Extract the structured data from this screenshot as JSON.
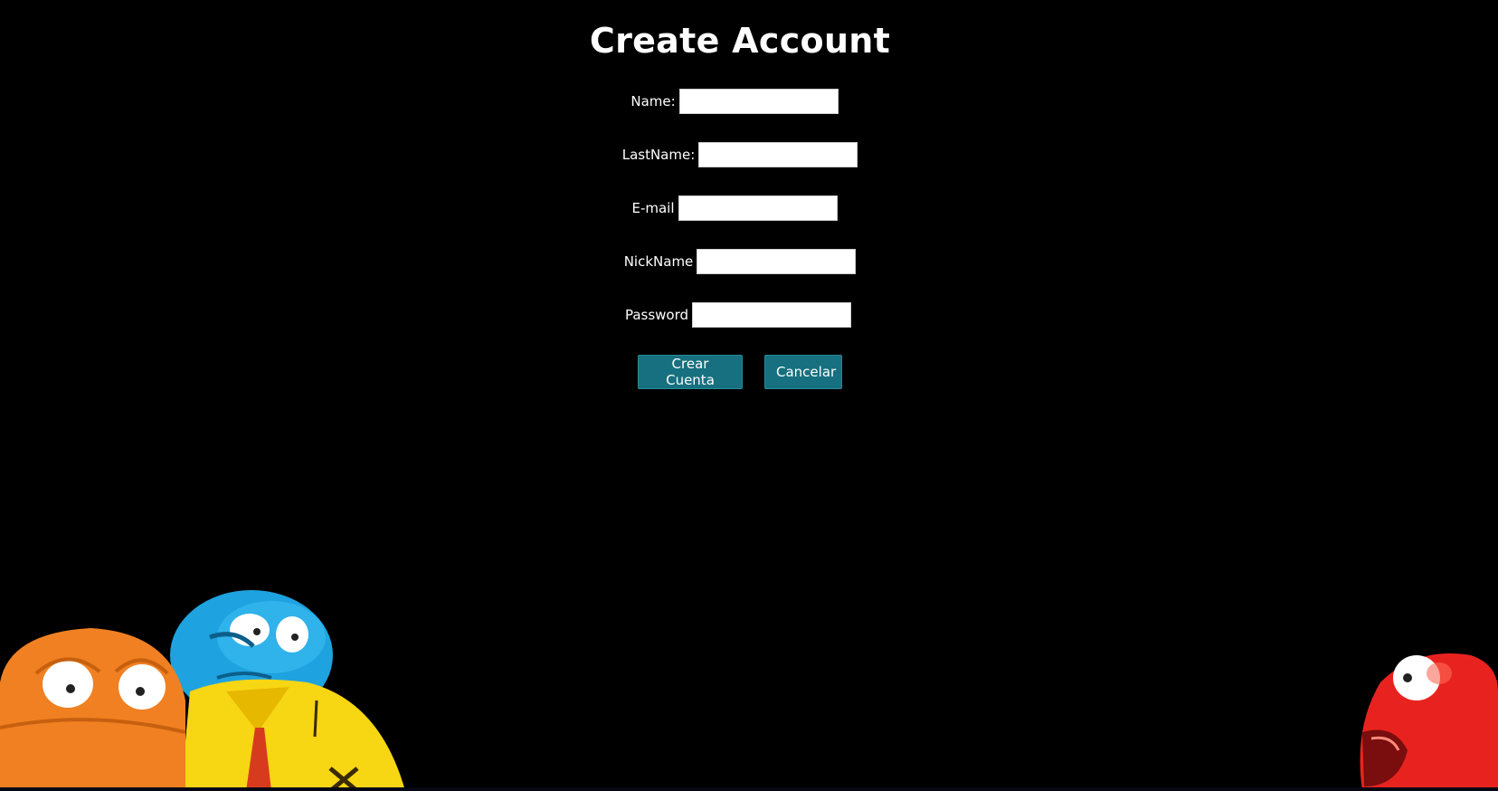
{
  "page": {
    "title": "Create Account"
  },
  "form": {
    "fields": [
      {
        "label": "Name:",
        "value": "",
        "placeholder": ""
      },
      {
        "label": "LastName:",
        "value": "",
        "placeholder": ""
      },
      {
        "label": "E-mail",
        "value": "",
        "placeholder": ""
      },
      {
        "label": "NickName",
        "value": "",
        "placeholder": ""
      },
      {
        "label": "Password",
        "value": "",
        "placeholder": ""
      }
    ],
    "buttons": {
      "create_label": "Crear Cuenta",
      "cancel_label": "Cancelar"
    }
  },
  "decor": {
    "characters": [
      "orange-monster-illustration",
      "blue-yellow-monster-illustration",
      "red-monster-illustration"
    ]
  },
  "colors": {
    "background": "#000000",
    "button": "#16707f",
    "text": "#ffffff"
  }
}
